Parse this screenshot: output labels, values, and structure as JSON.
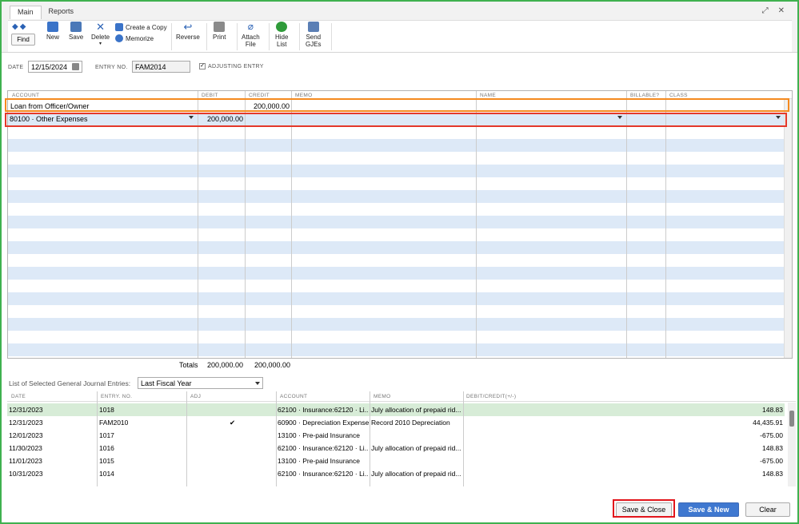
{
  "tabs": [
    "Main",
    "Reports"
  ],
  "window_controls": [
    "⤢",
    "✕"
  ],
  "toolbar": {
    "find": "Find",
    "new": "New",
    "save": "Save",
    "delete": "Delete",
    "create_copy": "Create a Copy",
    "memorize": "Memorize",
    "reverse": "Reverse",
    "print": "Print",
    "attach_file_1": "Attach",
    "attach_file_2": "File",
    "hide_list_1": "Hide",
    "hide_list_2": "List",
    "send_gjes_1": "Send",
    "send_gjes_2": "GJEs"
  },
  "header": {
    "date_label": "DATE",
    "date_value": "12/15/2024",
    "entry_label": "ENTRY NO.",
    "entry_value": "FAM2014",
    "adjusting_label": "ADJUSTING ENTRY",
    "adjusting_checked": "✓"
  },
  "grid": {
    "columns": [
      "ACCOUNT",
      "DEBIT",
      "CREDIT",
      "MEMO",
      "NAME",
      "BILLABLE?",
      "CLASS"
    ],
    "rows": [
      {
        "account": "Loan from Officer/Owner",
        "debit": "",
        "credit": "200,000.00"
      },
      {
        "account": "80100 · Other Expenses",
        "debit": "200,000.00",
        "credit": ""
      }
    ],
    "totals_label": "Totals",
    "total_debit": "200,000.00",
    "total_credit": "200,000.00"
  },
  "list": {
    "label": "List of Selected General Journal Entries:",
    "filter": "Last Fiscal Year",
    "columns": [
      "DATE",
      "ENTRY. NO.",
      "ADJ",
      "ACCOUNT",
      "MEMO",
      "DEBIT/CREDIT(+/-)"
    ],
    "rows": [
      {
        "date": "12/31/2023",
        "entry": "1018",
        "adj": "",
        "account": "62100 · Insurance:62120 · Li...",
        "memo": "July allocation of prepaid rid...",
        "amount": "148.83"
      },
      {
        "date": "12/31/2023",
        "entry": "FAM2010",
        "adj": "✔",
        "account": "60900 · Depreciation Expense",
        "memo": "Record 2010 Depreciation",
        "amount": "44,435.91"
      },
      {
        "date": "12/01/2023",
        "entry": "1017",
        "adj": "",
        "account": "13100 · Pre-paid Insurance",
        "memo": "",
        "amount": "-675.00"
      },
      {
        "date": "11/30/2023",
        "entry": "1016",
        "adj": "",
        "account": "62100 · Insurance:62120 · Li...",
        "memo": "July allocation of prepaid rid...",
        "amount": "148.83"
      },
      {
        "date": "11/01/2023",
        "entry": "1015",
        "adj": "",
        "account": "13100 · Pre-paid Insurance",
        "memo": "",
        "amount": "-675.00"
      },
      {
        "date": "10/31/2023",
        "entry": "1014",
        "adj": "",
        "account": "62100 · Insurance:62120 · Li...",
        "memo": "July allocation of prepaid rid...",
        "amount": "148.83"
      }
    ]
  },
  "buttons": {
    "save_close": "Save & Close",
    "save_new": "Save & New",
    "clear": "Clear"
  },
  "colors": {
    "frame": "#3fb14f",
    "highlight_orange": "#f58a1f",
    "highlight_red": "#e4382a",
    "row_stripe": "#dde9f7",
    "selected_row": "#d7ecd7",
    "primary_button": "#3f78d0"
  }
}
